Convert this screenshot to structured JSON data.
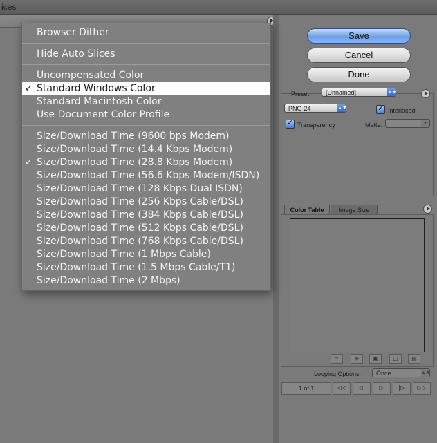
{
  "window": {
    "title_fragment": "ices"
  },
  "menu": {
    "items": [
      {
        "label": "Browser Dither",
        "checked": false,
        "selected": false
      },
      {
        "label": "Hide Auto Slices",
        "checked": false,
        "selected": false
      },
      {
        "label": "Uncompensated Color",
        "checked": false,
        "selected": false
      },
      {
        "label": "Standard Windows Color",
        "checked": true,
        "selected": true
      },
      {
        "label": "Standard Macintosh Color",
        "checked": false,
        "selected": false
      },
      {
        "label": "Use Document Color Profile",
        "checked": false,
        "selected": false
      },
      {
        "label": "Size/Download Time (9600 bps Modem)",
        "checked": false,
        "selected": false
      },
      {
        "label": "Size/Download Time (14.4 Kbps Modem)",
        "checked": false,
        "selected": false
      },
      {
        "label": "Size/Download Time (28.8 Kbps Modem)",
        "checked": true,
        "selected": false
      },
      {
        "label": "Size/Download Time (56.6 Kbps Modem/ISDN)",
        "checked": false,
        "selected": false
      },
      {
        "label": "Size/Download Time (128 Kbps Dual ISDN)",
        "checked": false,
        "selected": false
      },
      {
        "label": "Size/Download Time (256 Kbps Cable/DSL)",
        "checked": false,
        "selected": false
      },
      {
        "label": "Size/Download Time (384 Kbps Cable/DSL)",
        "checked": false,
        "selected": false
      },
      {
        "label": "Size/Download Time (512 Kbps Cable/DSL)",
        "checked": false,
        "selected": false
      },
      {
        "label": "Size/Download Time (768 Kbps Cable/DSL)",
        "checked": false,
        "selected": false
      },
      {
        "label": "Size/Download Time (1 Mbps Cable)",
        "checked": false,
        "selected": false
      },
      {
        "label": "Size/Download Time (1.5 Mbps Cable/T1)",
        "checked": false,
        "selected": false
      },
      {
        "label": "Size/Download Time (2 Mbps)",
        "checked": false,
        "selected": false
      }
    ],
    "checkmark_glyph": "✓"
  },
  "buttons": {
    "save": "Save",
    "cancel": "Cancel",
    "done": "Done"
  },
  "settings": {
    "preset_label": "Preset:",
    "preset_value": "[Unnamed]",
    "format_value": "PNG-24",
    "interlaced_label": "Interlaced",
    "interlaced_checked": true,
    "transparency_label": "Transparency",
    "transparency_checked": true,
    "matte_label": "Matte:",
    "matte_value": ""
  },
  "tabs": {
    "color_table": "Color Table",
    "image_size": "Image Size"
  },
  "animation": {
    "looping_label": "Looping Options:",
    "looping_value": "Once",
    "frame_counter": "1 of 1"
  },
  "icons": {
    "panel_menu": "flyout-arrow-icon",
    "color_table_tools": [
      "map-color-icon",
      "web-shift-icon",
      "lock-color-icon",
      "new-color-icon",
      "trash-icon"
    ],
    "nav": [
      "first-frame-icon",
      "previous-frame-icon",
      "play-icon",
      "next-frame-icon",
      "last-frame-icon"
    ]
  },
  "colors": {
    "accent": "#5a8de0",
    "menu_bg": "#808080",
    "menu_highlight": "#ffffff"
  }
}
